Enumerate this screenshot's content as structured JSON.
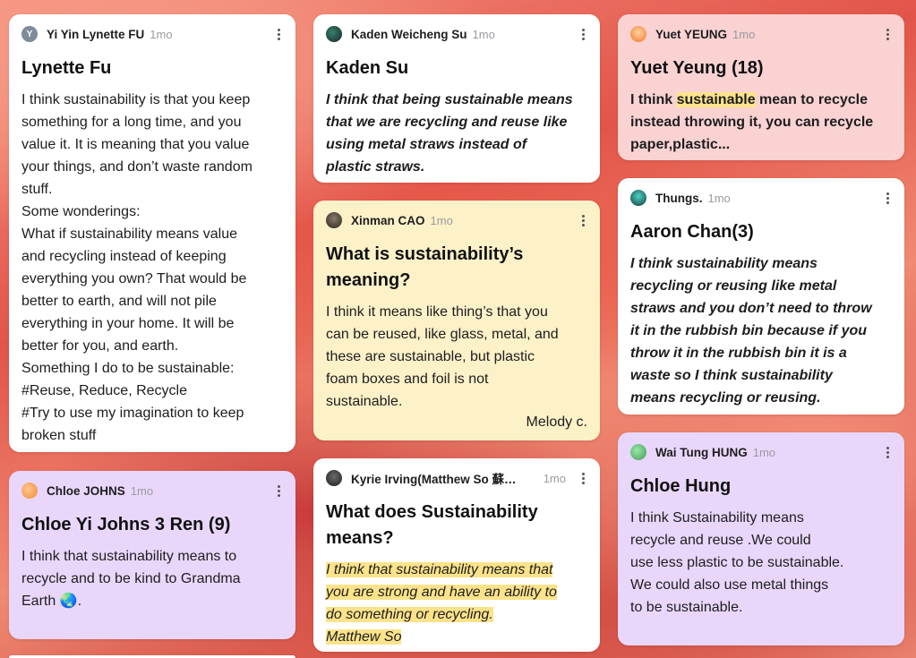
{
  "posts": {
    "p1": {
      "author": "Yi Yin Lynette FU",
      "time": "1mo",
      "avatar_letter": "Y",
      "title": "Lynette Fu",
      "lines": [
        "I think sustainability is that you keep",
        "something for a long time, and you",
        "value it. It is meaning that you value",
        "your things, and don’t waste random",
        "stuff.",
        "Some wonderings:",
        "What if sustainability means value",
        "and recycling instead of keeping",
        "everything you own? That would be",
        "better to earth, and will not pile",
        "everything in your home. It will be",
        "better for you, and earth.",
        "Something I do to be sustainable:",
        "#Reuse, Reduce, Recycle",
        "#Try to use my imagination to keep",
        "broken stuff"
      ]
    },
    "p2": {
      "author": "Chloe JOHNS",
      "time": "1mo",
      "title": "Chloe Yi Johns 3 Ren (9)",
      "lines": [
        "I think that sustainability means to",
        "recycle and to be kind to Grandma",
        "Earth 🌏."
      ]
    },
    "p3": {
      "author": "Kaden Weicheng Su",
      "time": "1mo",
      "title": "Kaden Su",
      "lines": [
        "I think that being sustainable means",
        "that we are recycling and reuse like",
        "using metal straws instead of",
        "plastic straws."
      ]
    },
    "p4": {
      "author": "Xinman CAO",
      "time": "1mo",
      "title_lines": [
        "What is sustainability’s",
        "meaning?"
      ],
      "lines": [
        "I think it means like thing’s that you",
        "can be reused, like glass, metal, and",
        "these are sustainable, but plastic",
        "foam boxes and foil is not",
        "sustainable."
      ],
      "signature": "Melody c."
    },
    "p5": {
      "author": "Kyrie Irving(Matthew So 蘇…",
      "time": "1mo",
      "title_lines": [
        "What does Sustainability",
        "means?"
      ],
      "lines": [
        "I think that sustainability means that",
        "you are strong and have an ability to",
        "do something or recycling.",
        "Matthew So"
      ]
    },
    "p6": {
      "author": "Yuet YEUNG",
      "time": "1mo",
      "title": "Yuet Yeung (18)",
      "line1_pre": "I think ",
      "line1_hl": "sustainable",
      "line1_post": " mean to recycle",
      "lines_rest": [
        "instead throwing it, you can recycle",
        "paper,plastic..."
      ]
    },
    "p7": {
      "author": "Thungs.",
      "time": "1mo",
      "title": "Aaron Chan(3)",
      "lines": [
        "I think sustainability means",
        "recycling or reusing like metal",
        "straws and you don’t need to throw",
        "it in the rubbish bin because if you",
        "throw it in the rubbish bin it is a",
        "waste so I think sustainability",
        "means recycling or reusing."
      ]
    },
    "p8": {
      "author": "Wai Tung HUNG",
      "time": "1mo",
      "title": "Chloe Hung",
      "lines": [
        "I think Sustainability means",
        "recycle and  reuse .We could",
        "use less plastic to be sustainable.",
        "We could also use metal  things",
        "to be sustainable."
      ]
    }
  },
  "colors": {
    "white_card": "#ffffff",
    "yellow_card": "#fdf1c8",
    "pink_card": "#fad2d2",
    "lavender_card": "#e9d7fb",
    "highlight": "#fce38a"
  },
  "icons": {
    "menu": "more-vertical-icon"
  }
}
